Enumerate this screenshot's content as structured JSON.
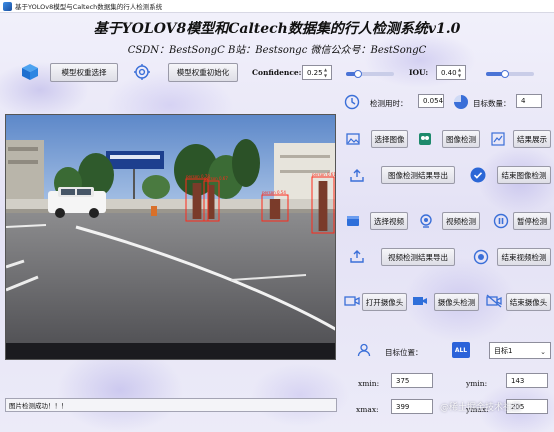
{
  "window": {
    "title": "基于YOLOv8模型与Caltech数据集的行人检测系统"
  },
  "header": {
    "title": "基于YOLOV8模型和Caltech数据集的行人检测系统v1.0",
    "subtitle": "CSDN：BestSongC   B站：Bestsongc   微信公众号：BestSongC"
  },
  "top_controls": {
    "model_select_label": "模型权重选择",
    "model_init_label": "模型权重初始化",
    "confidence_label": "Confidence:",
    "confidence_value": "0.25",
    "confidence_level": 0.25,
    "iou_label": "IOU:",
    "iou_value": "0.40",
    "iou_level": 0.4
  },
  "stats": {
    "time_label": "检测用时：",
    "time_value": "0.054",
    "count_label": "目标数量：",
    "count_value": "4"
  },
  "image_section": {
    "select_image": "选择图像",
    "detect_image": "图像检测",
    "show_result": "结果展示",
    "export_image": "图像检测结果导出",
    "end_image": "结束图像检测"
  },
  "video_section": {
    "select_video": "选择视频",
    "detect_video": "视频检测",
    "pause_detect": "暂停检测",
    "export_video": "视频检测结果导出",
    "end_video": "结束视频检测"
  },
  "camera_section": {
    "open_camera": "打开摄像头",
    "camera_detect": "摄像头检测",
    "close_camera": "结束摄像头"
  },
  "target": {
    "position_label": "目标位置：",
    "all_badge": "ALL",
    "selected": "目标1",
    "xmin_label": "xmin:",
    "xmin_value": "375",
    "ymin_label": "ymin:",
    "ymin_value": "143",
    "xmax_label": "xmax:",
    "xmax_value": "399",
    "ymax_label": "ymax:",
    "ymax_value": "205"
  },
  "status_bar": {
    "text": "图片检测成功！！！"
  },
  "watermark": "@稀土掘金技术社区",
  "detections": [
    {
      "label": "person 0.78"
    },
    {
      "label": "person 0.67"
    },
    {
      "label": "person 0.54"
    },
    {
      "label": "person 0.61"
    }
  ],
  "colors": {
    "accent": "#3a6fd8",
    "detection_box": "#ff2a1a"
  }
}
